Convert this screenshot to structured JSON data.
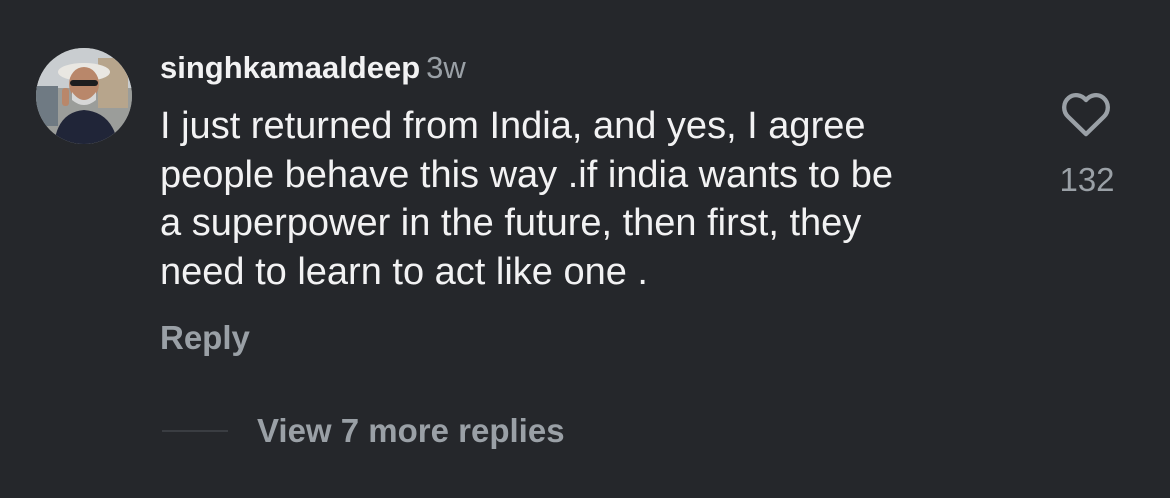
{
  "comment": {
    "username": "singhkamaaldeep",
    "timestamp": "3w",
    "text_lines": [
      "I just returned from India, and yes, I agree",
      "people behave this way .if india wants to be",
      "a superpower in the future, then first, they",
      "need to learn to act like one ."
    ],
    "reply_label": "Reply",
    "like_count": "132",
    "view_replies_label": "View 7 more replies"
  },
  "icons": {
    "like": "heart-outline-icon",
    "avatar": "profile-avatar"
  },
  "colors": {
    "background": "#25272b",
    "primary_text": "#f2f2f3",
    "secondary_text": "#9aa0a6"
  }
}
